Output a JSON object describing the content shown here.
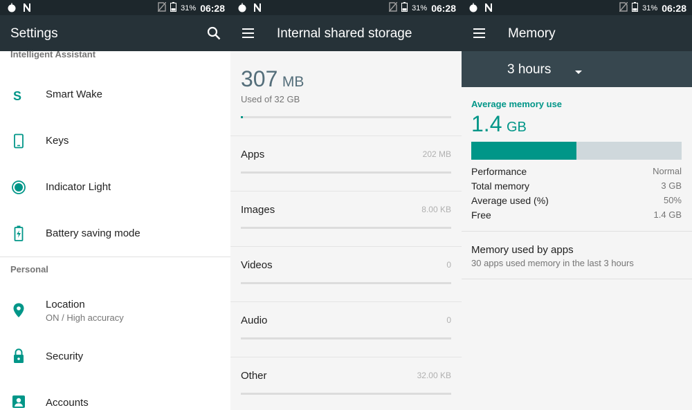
{
  "status": {
    "battery": "31%",
    "time": "06:28"
  },
  "settings": {
    "title": "Settings",
    "section_intelligent": "Intelligent Assistant",
    "items": [
      {
        "label": "Smart Wake"
      },
      {
        "label": "Keys"
      },
      {
        "label": "Indicator Light"
      },
      {
        "label": "Battery saving mode"
      }
    ],
    "section_personal": "Personal",
    "personal": [
      {
        "label": "Location",
        "sub": "ON / High accuracy"
      },
      {
        "label": "Security"
      },
      {
        "label": "Accounts"
      }
    ]
  },
  "storage": {
    "title": "Internal shared storage",
    "used_value": "307",
    "used_unit": "MB",
    "used_of": "Used of 32 GB",
    "used_fraction": 0.0094,
    "rows": [
      {
        "label": "Apps",
        "value": "202 MB"
      },
      {
        "label": "Images",
        "value": "8.00 KB"
      },
      {
        "label": "Videos",
        "value": "0"
      },
      {
        "label": "Audio",
        "value": "0"
      },
      {
        "label": "Other",
        "value": "32.00 KB"
      }
    ]
  },
  "memory": {
    "title": "Memory",
    "period": "3 hours",
    "avg_label": "Average memory use",
    "avg_value": "1.4",
    "avg_unit": "GB",
    "avg_fraction": 0.5,
    "stats": [
      {
        "key": "Performance",
        "value": "Normal"
      },
      {
        "key": "Total memory",
        "value": "3 GB"
      },
      {
        "key": "Average used (%)",
        "value": "50%"
      },
      {
        "key": "Free",
        "value": "1.4 GB"
      }
    ],
    "apps_title": "Memory used by apps",
    "apps_sub": "30 apps used memory in the last 3 hours"
  },
  "colors": {
    "accent": "#009688",
    "appbar": "#263238",
    "statusbar": "#1d272c",
    "bar_track": "#cfd8dc"
  }
}
